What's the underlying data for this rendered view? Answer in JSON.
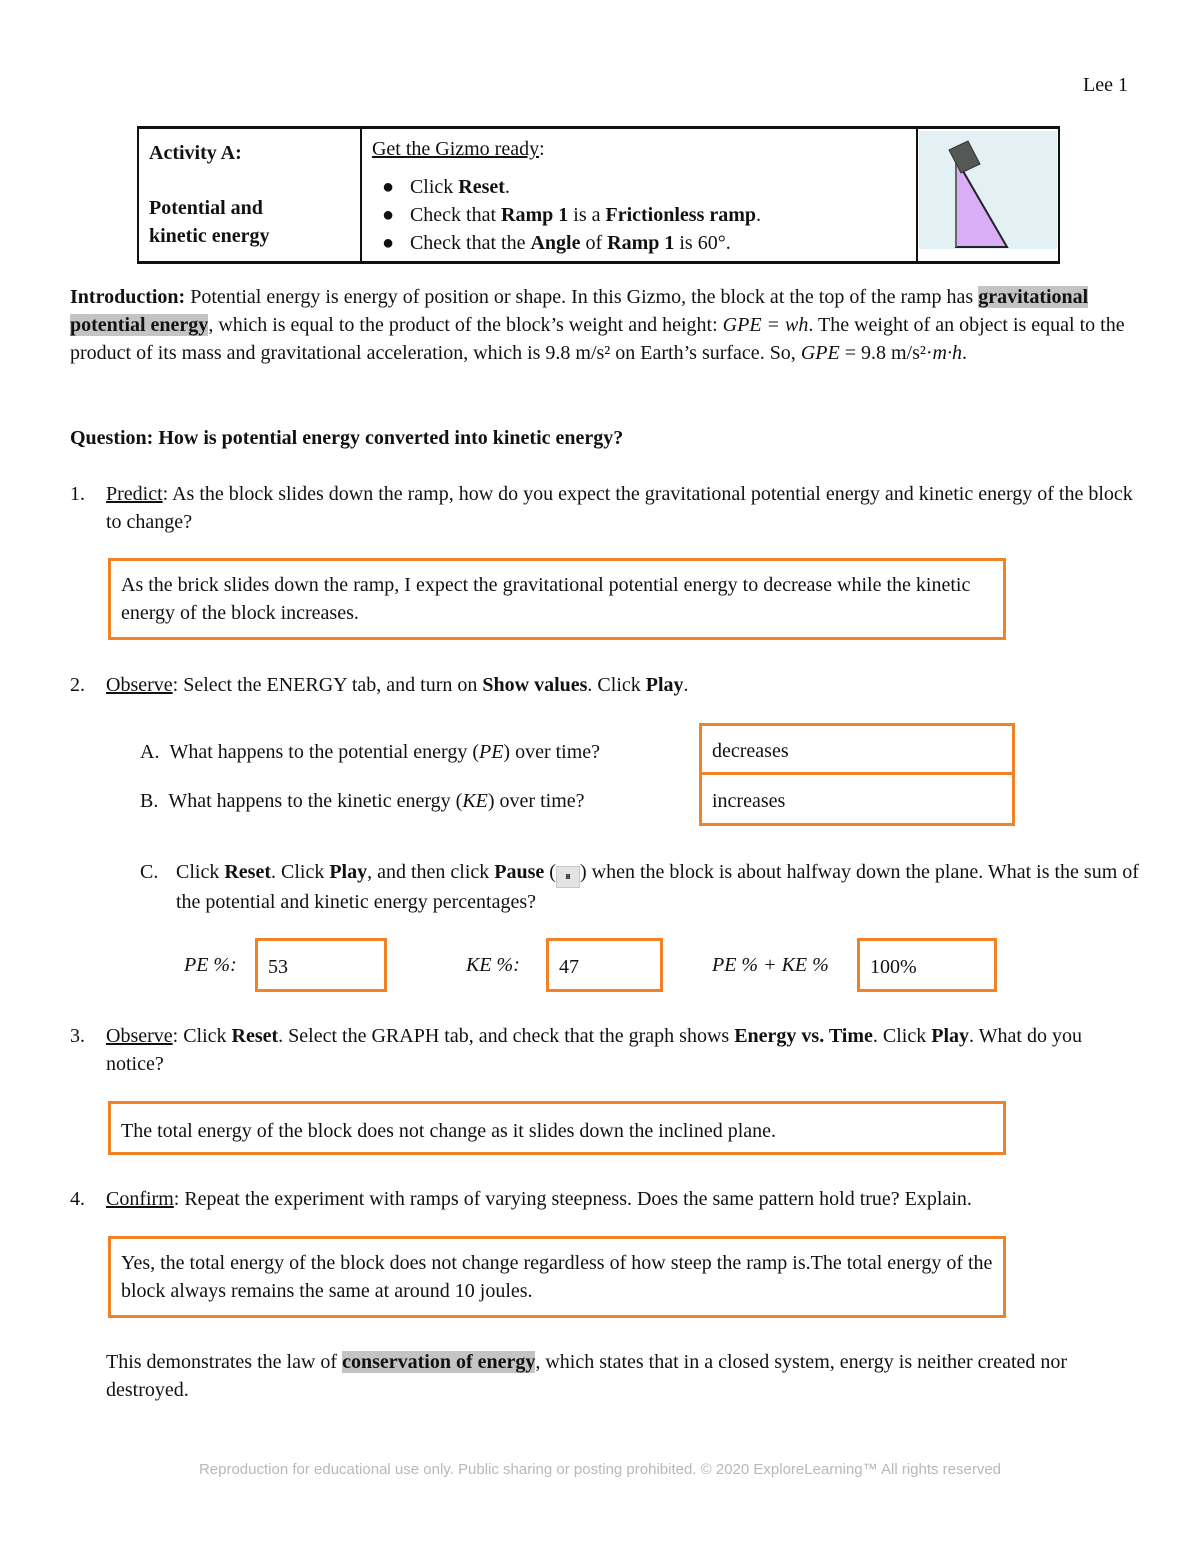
{
  "header": {
    "page_label": "Lee 1"
  },
  "activity_table": {
    "col1": {
      "line1": "Activity A:",
      "line2": "Potential and",
      "line3": "kinetic energy"
    },
    "col2": {
      "heading": "Get the Gizmo ready",
      "heading_suffix": ":",
      "items": [
        {
          "pre": "Click ",
          "b1": "Reset",
          "mid": ".",
          "b2": "",
          "post": ""
        },
        {
          "pre": "Check that ",
          "b1": "Ramp 1",
          "mid": " is a ",
          "b2": "Frictionless ramp",
          "post": "."
        },
        {
          "pre": "Check that the ",
          "b1": "Angle",
          "mid": " of ",
          "b2": "Ramp 1",
          "post": " is 60°."
        }
      ]
    },
    "image": {
      "icon": "ramp-with-block-illustration",
      "colors": {
        "background": "#e3f1f5",
        "ramp": "#d9aef7",
        "block": "#555855"
      }
    }
  },
  "introduction": {
    "label": "Introduction:",
    "t1": " Potential energy is energy of position or shape. In this Gizmo, the block at the top of the ramp has ",
    "highlight": "gravitational potential energy",
    "t2": ", which is equal to the product of the block’s weight and height: ",
    "f1": "GPE = wh",
    "t3": ". The weight of an object is equal to the product of its mass and gravitational acceleration, which is 9.8 m/s² on Earth’s surface. So, ",
    "f2": "GPE",
    "t4": " = 9.8 m/s²·",
    "f3": "m·h",
    "t5": "."
  },
  "question": {
    "text": "Question: How is potential energy converted into kinetic energy?"
  },
  "q1": {
    "number": "1.",
    "label": "Predict",
    "text": ": As the block slides down the ramp, how do you expect the gravitational potential energy and kinetic energy of the block to change?",
    "answer": "As the brick slides down the ramp, I expect the gravitational potential energy to decrease while the kinetic energy of the block increases."
  },
  "q2": {
    "number": "2.",
    "label": "Observe",
    "t1": ": Select the ENERGY tab, and turn on ",
    "b1": "Show values",
    "t2": ". Click ",
    "b2": "Play",
    "t3": ".",
    "a": {
      "letter": "A.",
      "pre": "What happens to the potential energy (",
      "var": "PE",
      "post": ") over time?",
      "answer": "decreases"
    },
    "b": {
      "letter": "B.",
      "pre": "What happens to the kinetic energy (",
      "var": "KE",
      "post": ") over time?",
      "answer": "increases"
    },
    "c": {
      "letter": "C.",
      "t1": "Click ",
      "b1": "Reset",
      "t2": ". Click ",
      "b2": "Play",
      "t3": ", and then click ",
      "b3": "Pause",
      "t4": " (",
      "pause_icon": "⏸",
      "t5": ") when the block is about halfway down the plane. What is the sum of the potential and kinetic energy percentages?",
      "pe_label": "PE %:",
      "pe_value": "53",
      "ke_label": "KE %:",
      "ke_value": "47",
      "sum_label": "PE % + KE %",
      "sum_value": "100%"
    }
  },
  "q3": {
    "number": "3.",
    "label": "Observe",
    "t1": ": Click ",
    "b1": "Reset",
    "t2": ". Select the GRAPH tab, and check that the graph shows ",
    "b2": "Energy vs. Time",
    "t3": ". Click ",
    "b3": "Play",
    "t4": ". What do you notice?",
    "answer": "The total energy of the block does not change as it slides down the inclined plane."
  },
  "q4": {
    "number": "4.",
    "label": "Confirm",
    "text": ": Repeat the experiment with ramps of varying steepness. Does the same pattern hold true? Explain.",
    "answer": "Yes, the total energy of the block does not change regardless of how steep the ramp is.The total energy of the block always remains the same at around 10 joules."
  },
  "conclusion": {
    "t1": "This demonstrates the law of ",
    "highlight": "conservation of energy",
    "t2": ", which states that in a closed system, energy is neither created nor destroyed."
  },
  "footer": {
    "text": "Reproduction for educational use only. Public sharing or posting prohibited. © 2020 ExploreLearning™ All rights reserved"
  },
  "colors": {
    "answer_border": "#f08228",
    "highlight": "#c4c4c4",
    "footer_text": "#b8b8b8"
  }
}
